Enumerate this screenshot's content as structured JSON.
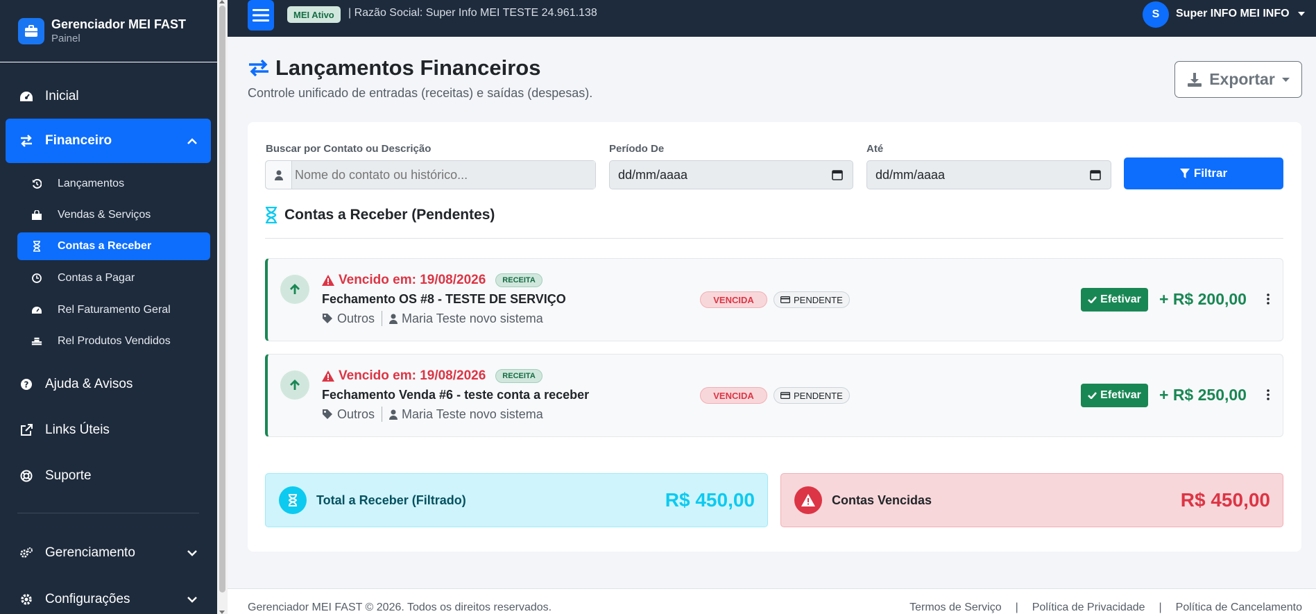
{
  "colors": {
    "sidebar": "#1e2b3c",
    "primary": "#0d6efd",
    "success": "#198754",
    "danger": "#dc3545",
    "info": "#0dcaf0"
  },
  "sidebar": {
    "brand_title": "Gerenciador MEI FAST",
    "brand_sub": "Painel",
    "items": [
      {
        "label": "Inicial",
        "icon": "dashboard-icon"
      },
      {
        "label": "Financeiro",
        "icon": "exchange-icon"
      },
      {
        "label": "Ajuda & Avisos",
        "icon": "help-icon"
      },
      {
        "label": "Links Úteis",
        "icon": "external-link-icon"
      },
      {
        "label": "Suporte",
        "icon": "lifebuoy-icon"
      },
      {
        "label": "Gerenciamento",
        "icon": "cogs-icon"
      },
      {
        "label": "Configurações",
        "icon": "gear-icon"
      }
    ],
    "sub_items": [
      {
        "label": "Lançamentos",
        "icon": "history-icon"
      },
      {
        "label": "Vendas & Serviços",
        "icon": "shopping-bag-icon"
      },
      {
        "label": "Contas a Receber",
        "icon": "hourglass-icon"
      },
      {
        "label": "Contas a Pagar",
        "icon": "clock-icon"
      },
      {
        "label": "Rel Faturamento Geral",
        "icon": "gauge-icon"
      },
      {
        "label": "Rel Produtos Vendidos",
        "icon": "boxes-icon"
      }
    ]
  },
  "topbar": {
    "badge": "MEI Ativo",
    "razao": "| Razão Social: Super Info MEI TESTE 24.961.138",
    "user_initial": "S",
    "user_name": "Super INFO MEI INFO"
  },
  "page": {
    "title": "Lançamentos Financeiros",
    "subtitle": "Controle unificado de entradas (receitas) e saídas (despesas).",
    "export_label": "Exportar"
  },
  "filters": {
    "search_label": "Buscar por Contato ou Descrição",
    "search_placeholder": "Nome do contato ou histórico...",
    "from_label": "Período De",
    "from_value": "dd/mm/aaaa",
    "to_label": "Até",
    "to_value": "dd/mm/aaaa",
    "filter_button": "Filtrar"
  },
  "section_title": "Contas a Receber (Pendentes)",
  "entries": [
    {
      "due": "Vencido em: 19/08/2026",
      "type_badge": "RECEITA",
      "description": "Fechamento OS #8 - TESTE DE SERVIÇO",
      "category": "Outros",
      "contact": "Maria Teste novo sistema",
      "status_badge": "VENCIDA",
      "payment_badge": "PENDENTE",
      "action": "Efetivar",
      "amount": "+ R$ 200,00"
    },
    {
      "due": "Vencido em: 19/08/2026",
      "type_badge": "RECEITA",
      "description": "Fechamento Venda #6 - teste conta a receber",
      "category": "Outros",
      "contact": "Maria Teste novo sistema",
      "status_badge": "VENCIDA",
      "payment_badge": "PENDENTE",
      "action": "Efetivar",
      "amount": "+ R$ 250,00"
    }
  ],
  "summary": {
    "total_label": "Total a Receber (Filtrado)",
    "total_value": "R$ 450,00",
    "overdue_label": "Contas Vencidas",
    "overdue_value": "R$ 450,00"
  },
  "footer": {
    "copyright": "Gerenciador MEI FAST © 2026. Todos os direitos reservados.",
    "links": [
      "Termos de Serviço",
      "Política de Privacidade",
      "Política de Cancelamento"
    ],
    "separator": "|"
  }
}
